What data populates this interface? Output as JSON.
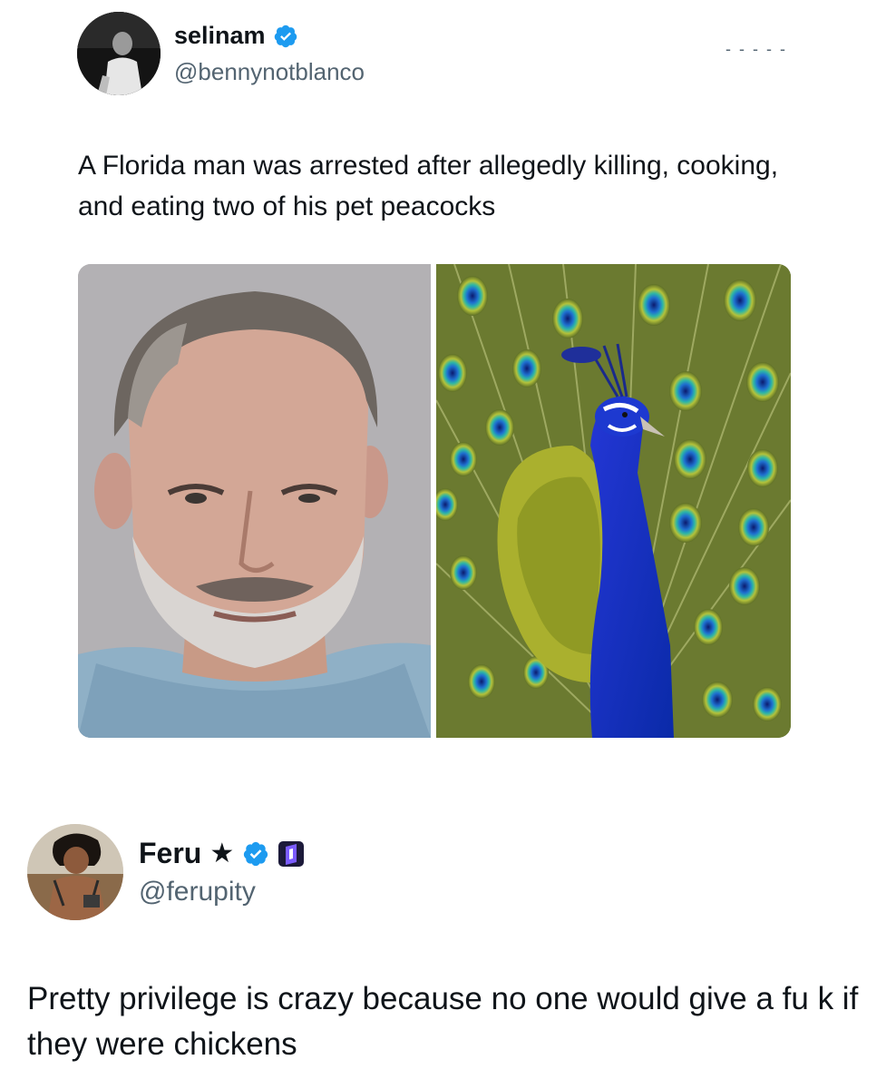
{
  "tweet": {
    "author": {
      "display_name": "selinam",
      "handle": "@bennynotblanco",
      "verified": true,
      "verified_icon": "verified-badge-icon"
    },
    "more_icon": "more-options-icon",
    "text": "A Florida man was arrested after allegedly killing, cooking, and eating two of his pet peacocks",
    "media": [
      {
        "kind": "image",
        "subject": "mugshot-photo"
      },
      {
        "kind": "image",
        "subject": "peacock-photo"
      }
    ]
  },
  "reply": {
    "author": {
      "display_name": "Feru",
      "star": "★",
      "handle": "@ferupity",
      "verified": true,
      "verified_icon": "verified-badge-icon",
      "affiliate_icon": "affiliate-badge-icon"
    },
    "text": "Pretty privilege is crazy because no one would give a fu  k if they were chickens"
  },
  "colors": {
    "text": "#0f1419",
    "secondary": "#536471",
    "verified": "#1d9bf0",
    "background": "#ffffff"
  }
}
